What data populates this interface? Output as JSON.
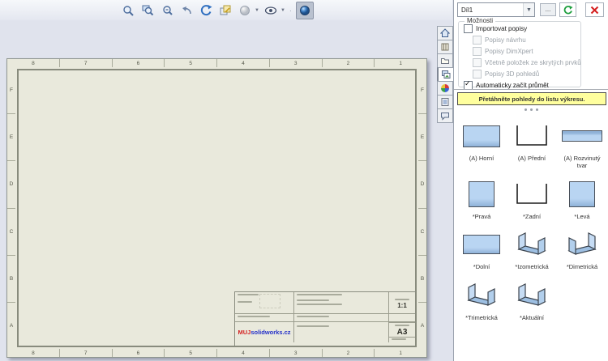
{
  "toolbar": {
    "icons": [
      "zoom-to-fit",
      "zoom-to-area",
      "zoom-in-out",
      "previous-view",
      "rotate-view",
      "pan-3d-view",
      "display-style",
      "hide-show-items",
      "view-settings"
    ]
  },
  "task_pane": {
    "tabs": [
      "solidworks-resources",
      "design-library",
      "file-explorer",
      "view-palette",
      "appearances-scenes",
      "custom-properties",
      "solidworks-forum"
    ],
    "active_tab": "view-palette",
    "model_combo": {
      "value": "Díl1"
    },
    "browse_label": "...",
    "options": {
      "title": "Možnosti",
      "checkboxes": [
        {
          "label": "Importovat popisy",
          "checked": false,
          "enabled": true
        },
        {
          "label": "Popisy návrhu",
          "checked": false,
          "enabled": false
        },
        {
          "label": "Popisy DimXpert",
          "checked": false,
          "enabled": false
        },
        {
          "label": "Včetně položek ze skrytých prvků",
          "checked": false,
          "enabled": false
        },
        {
          "label": "Popisy 3D pohledů",
          "checked": false,
          "enabled": false
        },
        {
          "label": "Automaticky začít průmět",
          "checked": true,
          "enabled": true
        }
      ]
    },
    "hint_banner": "Přetáhněte pohledy do listu výkresu.",
    "views": [
      {
        "label": "(A) Horní",
        "shape": "rect"
      },
      {
        "label": "(A) Přední",
        "shape": "channel-front"
      },
      {
        "label": "(A) Rozvinutý tvar",
        "shape": "flat"
      },
      {
        "label": "*Pravá",
        "shape": "square"
      },
      {
        "label": "*Zadní",
        "shape": "channel-front"
      },
      {
        "label": "*Levá",
        "shape": "square"
      },
      {
        "label": "*Dolní",
        "shape": "rect"
      },
      {
        "label": "*Izometrická",
        "shape": "channel-3d"
      },
      {
        "label": "*Dimetrická",
        "shape": "channel-3d"
      },
      {
        "label": "*Trimetrická",
        "shape": "channel-3d"
      },
      {
        "label": "*Aktuální",
        "shape": "channel-3d"
      }
    ]
  },
  "sheet": {
    "zone_columns": [
      "8",
      "7",
      "6",
      "5",
      "4",
      "3",
      "2",
      "1"
    ],
    "zone_rows": [
      "F",
      "E",
      "D",
      "C",
      "B",
      "A"
    ],
    "title_block": {
      "scale_value": "1:1",
      "format_value": "A3",
      "logo_red": "MUJ",
      "logo_blue": "solidworks.cz"
    }
  },
  "colors": {
    "viewport_bg": "#e0e3ed",
    "sheet_bg": "#e9e9dc",
    "thumb_fill": "#b9d5f2",
    "banner_bg": "#ffff9e",
    "refresh_green": "#1e9e3e",
    "close_red": "#d42020",
    "logo_red": "#d42323",
    "logo_blue": "#2430c8"
  }
}
